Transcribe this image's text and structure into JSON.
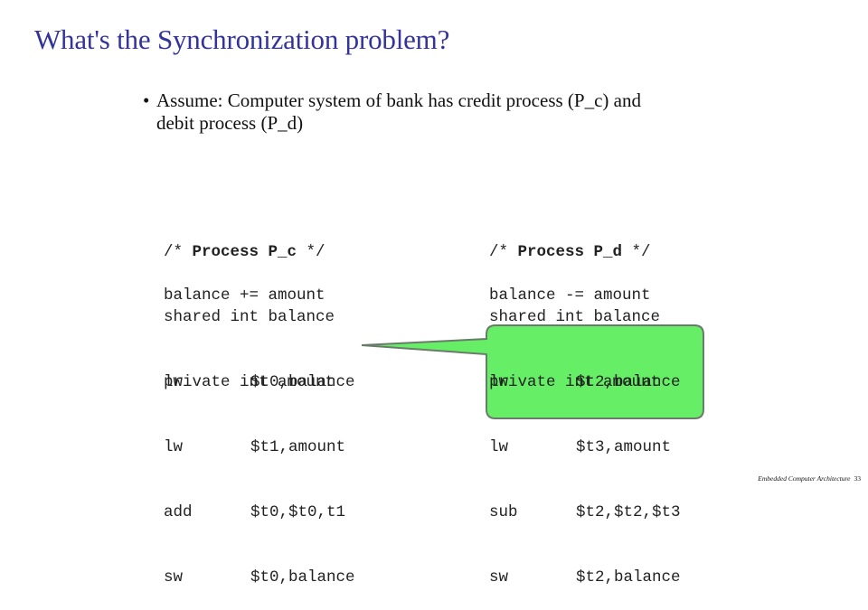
{
  "slide": {
    "title": "What's the Synchronization problem?",
    "bullet": {
      "symbol": "•",
      "line1": "Assume: Computer system of bank has credit process (P_c) and",
      "line2": "debit process (P_d)"
    },
    "process_c": {
      "comment_open": "/* ",
      "comment_name": "Process P_c",
      "comment_close": " */",
      "decl_shared": "shared int balance",
      "decl_private": "private int amount",
      "statement": "balance += amount",
      "asm": [
        {
          "op": "lw",
          "args": "$t0,balance"
        },
        {
          "op": "lw",
          "args": "$t1,amount"
        },
        {
          "op": "add",
          "args": "$t0,$t0,t1"
        },
        {
          "op": "sw",
          "args": "$t0,balance"
        }
      ]
    },
    "process_d": {
      "comment_open": "/* ",
      "comment_name": "Process P_d",
      "comment_close": " */",
      "decl_shared": "shared int balance",
      "decl_private": "private int amount",
      "statement": "balance -= amount",
      "asm": [
        {
          "op": "lw",
          "args": "$t2,balance"
        },
        {
          "op": "lw",
          "args": "$t3,amount"
        },
        {
          "op": "sub",
          "args": "$t2,$t2,$t3"
        },
        {
          "op": "sw",
          "args": "$t2,balance"
        }
      ]
    },
    "callout": {
      "fill_color": "#66ee66",
      "stroke_color": "#6b7b6b"
    },
    "footer": {
      "text": "Embedded Computer Architecture",
      "page": "33"
    }
  }
}
